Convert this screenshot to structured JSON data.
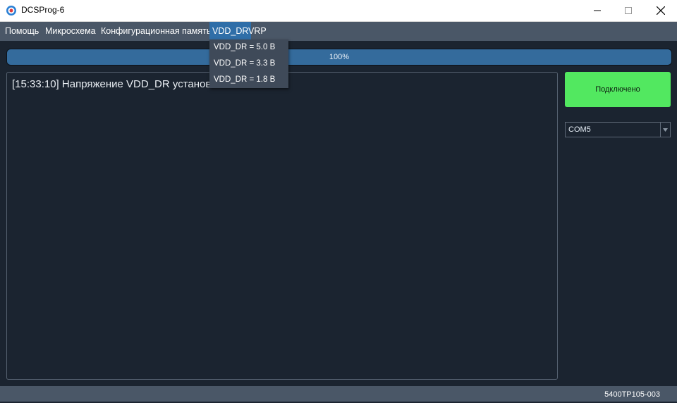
{
  "window": {
    "title": "DCSProg-6"
  },
  "menu": {
    "items": [
      "Помощь",
      "Микросхема",
      "Конфигурационная память",
      "VDD_DR",
      "VRP"
    ],
    "active": "VDD_DR"
  },
  "vdd_menu": {
    "options": [
      "VDD_DR = 5.0 В",
      "VDD_DR = 3.3 В",
      "VDD_DR = 1.8 В"
    ]
  },
  "progress": {
    "value_percent": 100,
    "label": "100%"
  },
  "log": {
    "lines": [
      "[15:33:10] Напряжение VDD_DR установ"
    ]
  },
  "connection": {
    "status_label": "Подключено",
    "color": "#52e860"
  },
  "port": {
    "selected": "COM5"
  },
  "status_bar": {
    "chip": "5400ТР105-003"
  },
  "colors": {
    "background": "#1b2430",
    "menubar": "#4a5767",
    "accent": "#2f6ea8",
    "progress_fill": "#346b9c"
  }
}
